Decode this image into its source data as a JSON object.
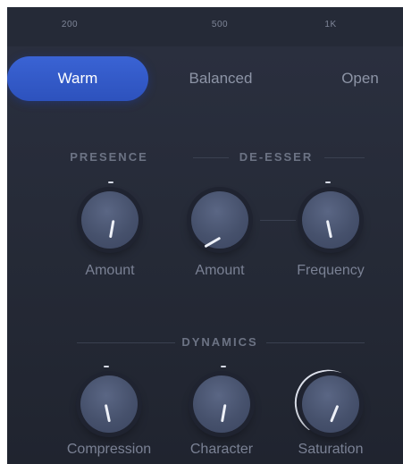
{
  "freq_scale": {
    "labels": [
      "200",
      "500",
      "1K"
    ]
  },
  "modes": {
    "items": [
      {
        "label": "Warm",
        "active": true
      },
      {
        "label": "Balanced",
        "active": false
      },
      {
        "label": "Open",
        "active": false
      }
    ]
  },
  "presence": {
    "title": "PRESENCE",
    "amount": {
      "label": "Amount",
      "value": 0.53
    }
  },
  "deesser": {
    "title": "DE-ESSER",
    "amount": {
      "label": "Amount",
      "value": 0.1
    },
    "frequency": {
      "label": "Frequency",
      "value": 0.46
    }
  },
  "dynamics": {
    "title": "DYNAMICS",
    "compression": {
      "label": "Compression",
      "value": 0.46
    },
    "character": {
      "label": "Character",
      "value": 0.53
    },
    "saturation": {
      "label": "Saturation",
      "value": 0.56
    }
  },
  "colors": {
    "accent": "#3a63d4",
    "panel": "#262b38",
    "knob": "#4a5570",
    "text_muted": "#7a8194"
  }
}
